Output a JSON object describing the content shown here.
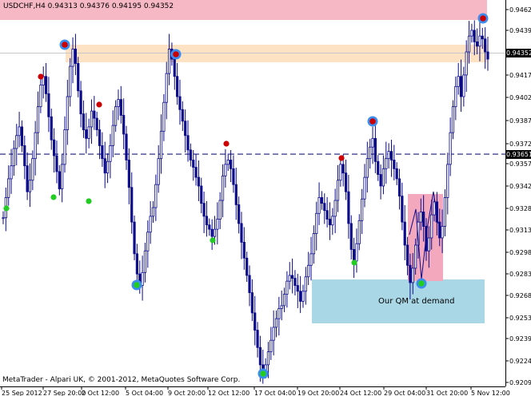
{
  "window": {
    "title": "USDCHF,H4  0.94313 0.94376 0.94195 0.94352",
    "footer": "MetaTrader - Alpari UK, © 2001-2012, MetaQuotes Software Corp."
  },
  "annotations": {
    "demand_label": "Our QM at demand"
  },
  "price_tags": {
    "current": "0.94352",
    "hline": "0.93651"
  },
  "chart_data": {
    "type": "candlestick",
    "symbol": "USDCHF",
    "timeframe": "H4",
    "ohlc_header": {
      "open": 0.94313,
      "high": 0.94376,
      "low": 0.94195,
      "close": 0.94352
    },
    "y_ticks": [
      "0.94625",
      "0.94395",
      "0.94352",
      "0.94175",
      "0.94020",
      "0.93875",
      "0.93725",
      "0.93651",
      "0.93575",
      "0.93425",
      "0.93280",
      "0.93130",
      "0.92980",
      "0.92835",
      "0.92685",
      "0.92535",
      "0.92390",
      "0.92240",
      "0.92090"
    ],
    "x_ticks": [
      "25 Sep 2012",
      "27 Sep 20:00",
      "2 Oct 12:00",
      "5 Oct 04:00",
      "9 Oct 20:00",
      "12 Oct 12:00",
      "17 Oct 04:00",
      "19 Oct 20:00",
      "24 Oct 12:00",
      "29 Oct 04:00",
      "31 Oct 20:00",
      "5 Nov 12:00"
    ],
    "ylim": [
      0.9204,
      0.9472
    ],
    "horizontal_line": 0.93651,
    "current_price": 0.94352,
    "colors": {
      "candles": "#0b0b8a",
      "top_zone": "#f6b8c4",
      "supply_band": "#fde3c4",
      "demand_zone": "#a9d7e6",
      "qm_box": "#f3a8bd",
      "red_marker": "#cc0000",
      "green_marker": "#22cc22",
      "ring": "#3b8df0"
    },
    "close_path": [
      0.9321,
      0.9335,
      0.9348,
      0.9357,
      0.9369,
      0.9378,
      0.9384,
      0.9371,
      0.9357,
      0.9339,
      0.9347,
      0.9362,
      0.938,
      0.9398,
      0.9413,
      0.9419,
      0.9407,
      0.9391,
      0.9375,
      0.9364,
      0.9353,
      0.9341,
      0.9358,
      0.9382,
      0.9405,
      0.9426,
      0.9438,
      0.9428,
      0.9409,
      0.9393,
      0.9382,
      0.9376,
      0.9384,
      0.9395,
      0.939,
      0.9382,
      0.9371,
      0.9362,
      0.9352,
      0.936,
      0.9371,
      0.9385,
      0.9398,
      0.9403,
      0.9392,
      0.9379,
      0.9361,
      0.9342,
      0.9318,
      0.9296,
      0.9282,
      0.9274,
      0.9283,
      0.9298,
      0.9311,
      0.9322,
      0.9328,
      0.9344,
      0.9362,
      0.9381,
      0.9401,
      0.9421,
      0.9438,
      0.9431,
      0.9419,
      0.9405,
      0.9396,
      0.9388,
      0.9378,
      0.9368,
      0.9361,
      0.9356,
      0.9349,
      0.9343,
      0.9331,
      0.9322,
      0.9316,
      0.9313,
      0.9308,
      0.9313,
      0.932,
      0.9333,
      0.935,
      0.9358,
      0.9361,
      0.9355,
      0.9344,
      0.933,
      0.9317,
      0.9304,
      0.9293,
      0.9281,
      0.9269,
      0.9255,
      0.9243,
      0.9231,
      0.9219,
      0.9214,
      0.9219,
      0.9228,
      0.9236,
      0.9245,
      0.9251,
      0.9258,
      0.926,
      0.9268,
      0.9277,
      0.9281,
      0.9279,
      0.9274,
      0.927,
      0.9263,
      0.927,
      0.928,
      0.9288,
      0.9296,
      0.931,
      0.9324,
      0.9335,
      0.9331,
      0.9326,
      0.932,
      0.9316,
      0.9322,
      0.9333,
      0.9347,
      0.9358,
      0.9352,
      0.9339,
      0.9317,
      0.9299,
      0.9291,
      0.9303,
      0.9319,
      0.9334,
      0.9349,
      0.9362,
      0.937,
      0.9376,
      0.936,
      0.9351,
      0.9343,
      0.9355,
      0.9362,
      0.9367,
      0.9361,
      0.9355,
      0.9348,
      0.9336,
      0.9318,
      0.9302,
      0.9288,
      0.9276,
      0.9286,
      0.9302,
      0.9318,
      0.9325,
      0.9315,
      0.9298,
      0.9307,
      0.9323,
      0.9332,
      0.9318,
      0.9307,
      0.9315,
      0.9335,
      0.9358,
      0.938,
      0.9398,
      0.9412,
      0.9419,
      0.9405,
      0.942,
      0.9436,
      0.9447,
      0.9451,
      0.9443,
      0.944,
      0.9447,
      0.9445,
      0.9436,
      0.9431
    ],
    "red_markers": [
      [
        0.9419,
        "27 Sep"
      ],
      [
        0.9407,
        "28 Sep"
      ],
      [
        0.9372,
        "11 Oct"
      ],
      [
        0.9361,
        "24 Oct"
      ],
      [
        0.9382,
        "26 Oct"
      ]
    ],
    "green_markers": [
      [
        0.9325,
        "24 Sep"
      ],
      [
        0.9333,
        "27 Sep"
      ],
      [
        0.9328,
        "1 Oct"
      ],
      [
        0.9301,
        "11 Oct"
      ],
      [
        0.929,
        "25 Oct"
      ]
    ],
    "ring_markers": [
      [
        0.9436,
        "27 Sep"
      ],
      [
        0.9433,
        "8 Oct"
      ],
      [
        0.9278,
        "4 Oct"
      ],
      [
        0.9389,
        "26 Oct"
      ],
      [
        0.9278,
        "30 Oct"
      ],
      [
        0.9213,
        "17 Oct"
      ],
      [
        0.946,
        "6 Nov"
      ]
    ]
  }
}
